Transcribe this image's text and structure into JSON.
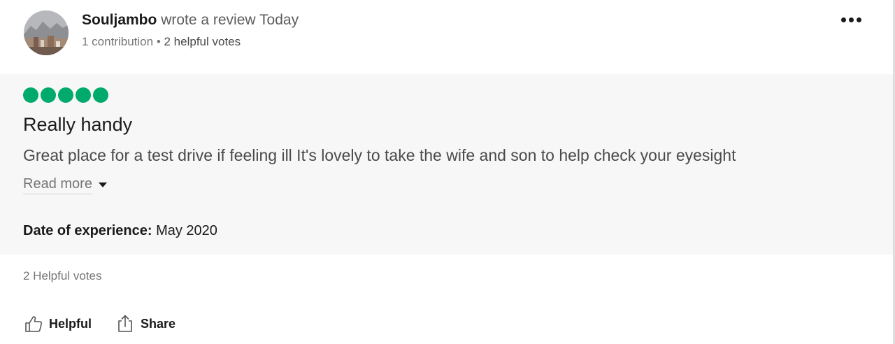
{
  "header": {
    "username": "Souljambo",
    "action_text": "wrote a review Today",
    "contributions": "1 contribution",
    "separator": "•",
    "helpful_votes": "2 helpful votes",
    "more_icon": "more-options-icon"
  },
  "review": {
    "rating": 5,
    "rating_color": "#00aa6c",
    "title": "Really handy",
    "text": "Great place for a test drive if feeling ill It's lovely to take the wife and son to help check your eyesight",
    "read_more": "Read more",
    "date_label": "Date of experience:",
    "date_value": "May 2020"
  },
  "footer": {
    "helpful_votes": "2 Helpful votes",
    "helpful_label": "Helpful",
    "share_label": "Share"
  },
  "colors": {
    "accent": "#00aa6c",
    "body_background": "#f6f7f6"
  }
}
